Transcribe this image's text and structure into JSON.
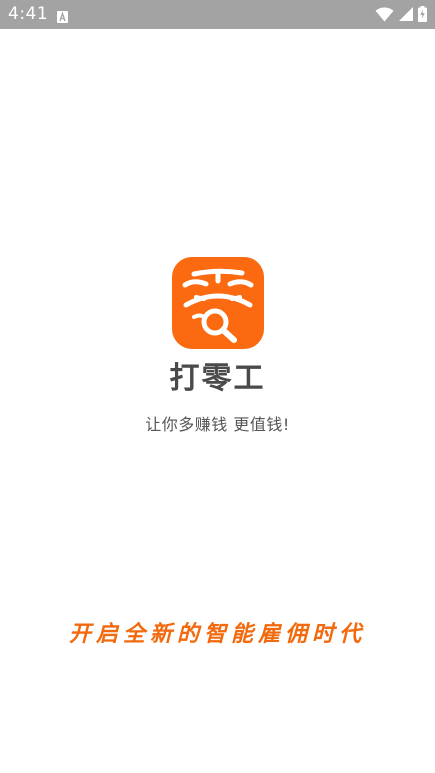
{
  "status_bar": {
    "time": "4:41",
    "notification_icon": "font-a-icon",
    "wifi_icon": "wifi-icon",
    "signal_icon": "cell-signal-icon",
    "battery_icon": "battery-charging-icon"
  },
  "splash": {
    "logo_icon": "ling-magnifier-logo-icon",
    "app_name": "打零工",
    "slogan": "让你多赚钱 更值钱!",
    "tagline": "开启全新的智能雇佣时代"
  },
  "colors": {
    "status_bar_bg": "#a3a3a3",
    "brand_orange": "#fb6a10",
    "tagline_orange": "#f26a0d",
    "app_name_gray": "#4a4a4a",
    "slogan_gray": "#555555",
    "background": "#ffffff"
  }
}
